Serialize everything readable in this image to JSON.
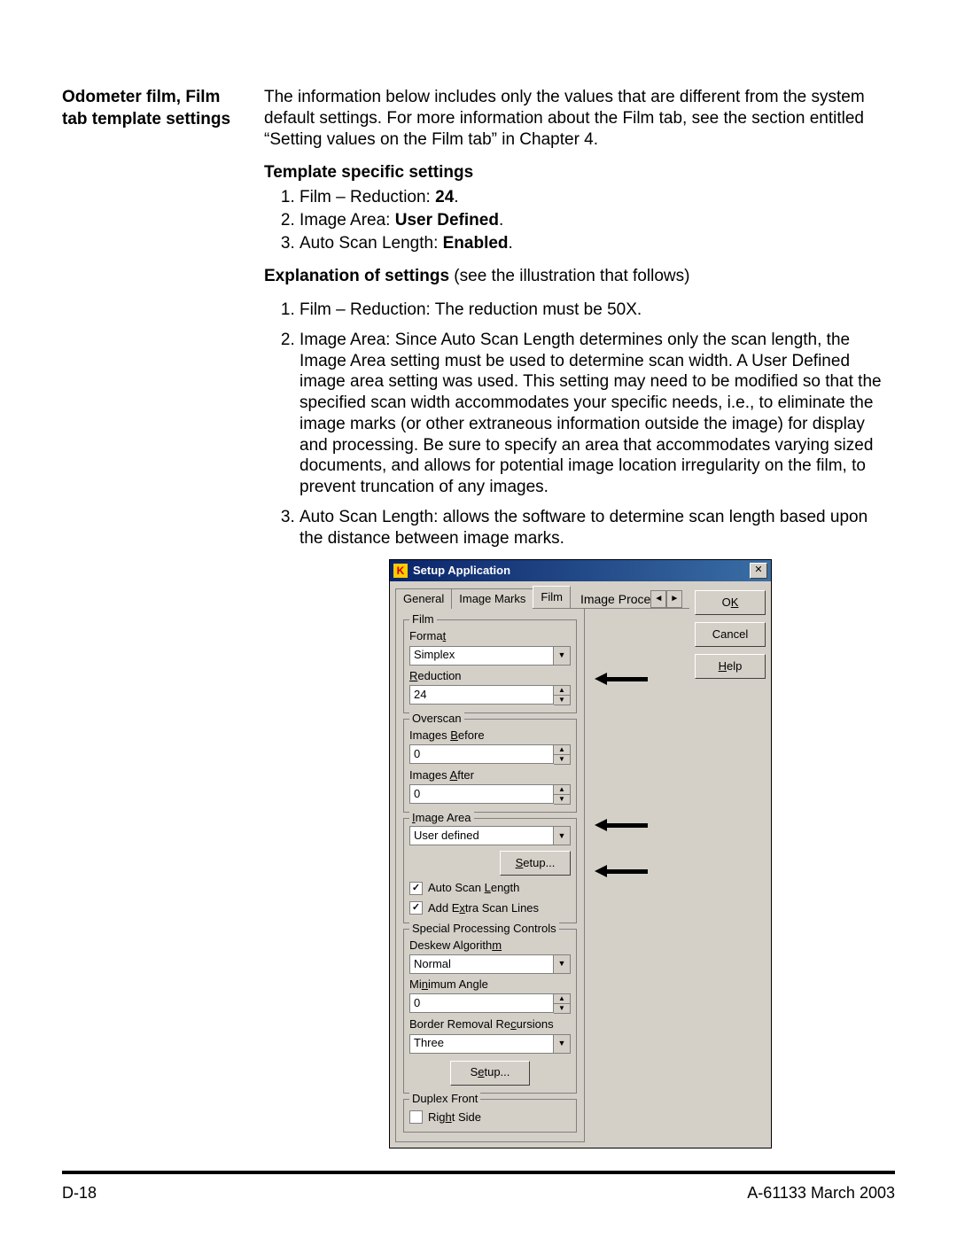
{
  "doc": {
    "section_title": "Odometer film, Film tab template settings",
    "intro": "The information below includes only the values that are different from the system default settings.  For more information about the Film tab, see the section entitled “Setting values on the Film tab” in Chapter 4.",
    "tss_heading": "Template specific settings",
    "s1_pre": "Film – Reduction: ",
    "s1_val": "24",
    "s1_post": ".",
    "s2_pre": "Image Area: ",
    "s2_val": "User Defined",
    "s2_post": ".",
    "s3_pre": "Auto Scan Length: ",
    "s3_val": "Enabled",
    "s3_post": ".",
    "exp_heading": "Explanation of settings",
    "exp_heading_rest": " see the illustration that follows)",
    "exp_heading_open": " (",
    "e1": "Film – Reduction: The reduction must be 50X.",
    "e2": "Image Area: Since Auto Scan Length determines only the scan length, the Image Area setting must be used to determine scan width. A User Defined image area setting was used. This setting may need to be modified so that the specified scan width accommodates your specific needs, i.e., to eliminate the image marks (or other extraneous information outside the image) for display and processing.  Be sure to specify an area that accommodates varying sized documents, and allows for potential image location irregularity on the film, to prevent truncation of any images.",
    "e3": "Auto Scan Length: allows the software to determine scan length based upon the distance between image marks.",
    "footer_left": "D-18",
    "footer_right": "A-61133  March 2003"
  },
  "dialog": {
    "title": "Setup Application",
    "tabs": {
      "general": "General",
      "image_marks": "Image Marks",
      "film": "Film",
      "trunc": "Image Proce"
    },
    "buttons": {
      "ok_pre": "O",
      "ok_u": "K",
      "cancel": "Cancel",
      "help_u": "H",
      "help_post": "elp",
      "setup_u": "S",
      "setup_mid": "etup...",
      "setup2_pre": "S",
      "setup2_u": "e",
      "setup2_post": "tup..."
    },
    "film_group": "Film",
    "format_u": "t",
    "format_pre": "Forma",
    "format_val": "Simplex",
    "reduction_u": "R",
    "reduction_post": "eduction",
    "reduction_val": "24",
    "overscan_group": "Overscan",
    "before_pre": "Images ",
    "before_u": "B",
    "before_post": "efore",
    "before_val": "0",
    "after_pre": "Images ",
    "after_u": "A",
    "after_post": "fter",
    "after_val": "0",
    "image_area_group_u": "I",
    "image_area_group_post": "mage Area",
    "image_area_val": "User defined",
    "auto_scan_pre": "Auto Scan ",
    "auto_scan_u": "L",
    "auto_scan_post": "ength",
    "auto_scan_checked": true,
    "extra_pre": "Add E",
    "extra_u": "x",
    "extra_post": "tra Scan Lines",
    "extra_checked": true,
    "spc_group": "Special Processing Controls",
    "deskew_pre": "Deskew Algorith",
    "deskew_u": "m",
    "deskew_val": "Normal",
    "minangle_pre": "Mi",
    "minangle_u": "n",
    "minangle_post": "imum Angle",
    "minangle_val": "0",
    "border_pre": "Border Removal Re",
    "border_u": "c",
    "border_post": "ursions",
    "border_val": "Three",
    "duplex_group": "Duplex Front",
    "right_pre": "Rig",
    "right_u": "h",
    "right_post": "t Side",
    "right_checked": false
  }
}
